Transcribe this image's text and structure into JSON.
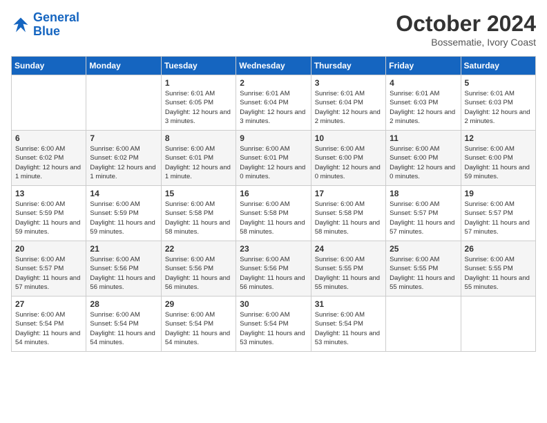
{
  "header": {
    "logo_line1": "General",
    "logo_line2": "Blue",
    "month": "October 2024",
    "location": "Bossematie, Ivory Coast"
  },
  "weekdays": [
    "Sunday",
    "Monday",
    "Tuesday",
    "Wednesday",
    "Thursday",
    "Friday",
    "Saturday"
  ],
  "weeks": [
    [
      {
        "day": "",
        "detail": ""
      },
      {
        "day": "",
        "detail": ""
      },
      {
        "day": "1",
        "detail": "Sunrise: 6:01 AM\nSunset: 6:05 PM\nDaylight: 12 hours and 3 minutes."
      },
      {
        "day": "2",
        "detail": "Sunrise: 6:01 AM\nSunset: 6:04 PM\nDaylight: 12 hours and 3 minutes."
      },
      {
        "day": "3",
        "detail": "Sunrise: 6:01 AM\nSunset: 6:04 PM\nDaylight: 12 hours and 2 minutes."
      },
      {
        "day": "4",
        "detail": "Sunrise: 6:01 AM\nSunset: 6:03 PM\nDaylight: 12 hours and 2 minutes."
      },
      {
        "day": "5",
        "detail": "Sunrise: 6:01 AM\nSunset: 6:03 PM\nDaylight: 12 hours and 2 minutes."
      }
    ],
    [
      {
        "day": "6",
        "detail": "Sunrise: 6:00 AM\nSunset: 6:02 PM\nDaylight: 12 hours and 1 minute."
      },
      {
        "day": "7",
        "detail": "Sunrise: 6:00 AM\nSunset: 6:02 PM\nDaylight: 12 hours and 1 minute."
      },
      {
        "day": "8",
        "detail": "Sunrise: 6:00 AM\nSunset: 6:01 PM\nDaylight: 12 hours and 1 minute."
      },
      {
        "day": "9",
        "detail": "Sunrise: 6:00 AM\nSunset: 6:01 PM\nDaylight: 12 hours and 0 minutes."
      },
      {
        "day": "10",
        "detail": "Sunrise: 6:00 AM\nSunset: 6:00 PM\nDaylight: 12 hours and 0 minutes."
      },
      {
        "day": "11",
        "detail": "Sunrise: 6:00 AM\nSunset: 6:00 PM\nDaylight: 12 hours and 0 minutes."
      },
      {
        "day": "12",
        "detail": "Sunrise: 6:00 AM\nSunset: 6:00 PM\nDaylight: 11 hours and 59 minutes."
      }
    ],
    [
      {
        "day": "13",
        "detail": "Sunrise: 6:00 AM\nSunset: 5:59 PM\nDaylight: 11 hours and 59 minutes."
      },
      {
        "day": "14",
        "detail": "Sunrise: 6:00 AM\nSunset: 5:59 PM\nDaylight: 11 hours and 59 minutes."
      },
      {
        "day": "15",
        "detail": "Sunrise: 6:00 AM\nSunset: 5:58 PM\nDaylight: 11 hours and 58 minutes."
      },
      {
        "day": "16",
        "detail": "Sunrise: 6:00 AM\nSunset: 5:58 PM\nDaylight: 11 hours and 58 minutes."
      },
      {
        "day": "17",
        "detail": "Sunrise: 6:00 AM\nSunset: 5:58 PM\nDaylight: 11 hours and 58 minutes."
      },
      {
        "day": "18",
        "detail": "Sunrise: 6:00 AM\nSunset: 5:57 PM\nDaylight: 11 hours and 57 minutes."
      },
      {
        "day": "19",
        "detail": "Sunrise: 6:00 AM\nSunset: 5:57 PM\nDaylight: 11 hours and 57 minutes."
      }
    ],
    [
      {
        "day": "20",
        "detail": "Sunrise: 6:00 AM\nSunset: 5:57 PM\nDaylight: 11 hours and 57 minutes."
      },
      {
        "day": "21",
        "detail": "Sunrise: 6:00 AM\nSunset: 5:56 PM\nDaylight: 11 hours and 56 minutes."
      },
      {
        "day": "22",
        "detail": "Sunrise: 6:00 AM\nSunset: 5:56 PM\nDaylight: 11 hours and 56 minutes."
      },
      {
        "day": "23",
        "detail": "Sunrise: 6:00 AM\nSunset: 5:56 PM\nDaylight: 11 hours and 56 minutes."
      },
      {
        "day": "24",
        "detail": "Sunrise: 6:00 AM\nSunset: 5:55 PM\nDaylight: 11 hours and 55 minutes."
      },
      {
        "day": "25",
        "detail": "Sunrise: 6:00 AM\nSunset: 5:55 PM\nDaylight: 11 hours and 55 minutes."
      },
      {
        "day": "26",
        "detail": "Sunrise: 6:00 AM\nSunset: 5:55 PM\nDaylight: 11 hours and 55 minutes."
      }
    ],
    [
      {
        "day": "27",
        "detail": "Sunrise: 6:00 AM\nSunset: 5:54 PM\nDaylight: 11 hours and 54 minutes."
      },
      {
        "day": "28",
        "detail": "Sunrise: 6:00 AM\nSunset: 5:54 PM\nDaylight: 11 hours and 54 minutes."
      },
      {
        "day": "29",
        "detail": "Sunrise: 6:00 AM\nSunset: 5:54 PM\nDaylight: 11 hours and 54 minutes."
      },
      {
        "day": "30",
        "detail": "Sunrise: 6:00 AM\nSunset: 5:54 PM\nDaylight: 11 hours and 53 minutes."
      },
      {
        "day": "31",
        "detail": "Sunrise: 6:00 AM\nSunset: 5:54 PM\nDaylight: 11 hours and 53 minutes."
      },
      {
        "day": "",
        "detail": ""
      },
      {
        "day": "",
        "detail": ""
      }
    ]
  ]
}
